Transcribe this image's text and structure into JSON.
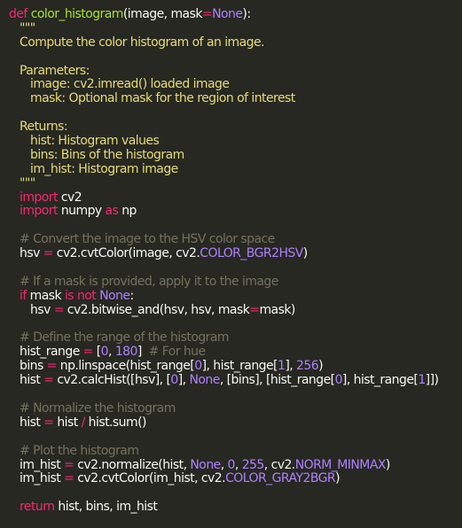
{
  "code": {
    "def_kw": "def",
    "func_name": "color_histogram",
    "func_params_open": "(image, mask",
    "func_eq": "=",
    "func_none": "None",
    "func_params_close": "):",
    "doc_open": "\"\"\"",
    "doc_summary": "Compute the color histogram of an image.",
    "doc_params_header": "Parameters:",
    "doc_param_image": "image: cv2.imread() loaded image",
    "doc_param_mask": "mask: Optional mask for the region of interest",
    "doc_returns_header": "Returns:",
    "doc_ret_hist": "hist: Histogram values",
    "doc_ret_bins": "bins: Bins of the histogram",
    "doc_ret_imhist": "im_hist: Histogram image",
    "doc_close": "\"\"\"",
    "import_kw": "import",
    "import_cv2": " cv2",
    "import_numpy": " numpy ",
    "as_kw": "as",
    "import_np": " np",
    "comment_hsv": "# Convert the image to the HSV color space",
    "hsv_lhs": "hsv ",
    "eq": "=",
    "hsv_rhs_a": " cv2.cvtColor(image, cv2.",
    "hsv_const": "COLOR_BGR2HSV",
    "close_paren": ")",
    "comment_mask": "# If a mask is provided, apply it to the image",
    "if_kw": "if",
    "if_mask": " mask ",
    "is_kw": "is",
    "not_kw": "not",
    "none_kw": "None",
    "colon": ":",
    "bitwise_rhs_a": " cv2.bitwise_and(hsv, hsv, mask",
    "bitwise_rhs_b": "mask)",
    "comment_range": "# Define the range of the histogram",
    "range_lhs": "hist_range ",
    "range_open": " [",
    "num_0": "0",
    "comma_sp": ", ",
    "num_180": "180",
    "range_close": "]  ",
    "comment_hue": "# For hue",
    "bins_lhs": "bins ",
    "bins_rhs_a": " np.linspace(hist_range[",
    "bins_rhs_b": "], hist_range[",
    "num_1": "1",
    "bins_rhs_c": "], ",
    "num_256": "256",
    "calc_lhs": "hist ",
    "calc_rhs_a": " cv2.calcHist([hsv], [",
    "calc_rhs_b": "], ",
    "calc_rhs_c": ", [bins], [hist_range[",
    "calc_rhs_d": "], hist_range[",
    "calc_rhs_e": "]])",
    "comment_norm": "# Normalize the histogram",
    "norm_lhs": "hist ",
    "norm_rhs_a": " hist ",
    "slash": "/",
    "norm_rhs_b": " hist.sum()",
    "comment_plot": "# Plot the histogram",
    "imh_lhs": "im_hist ",
    "imh_rhs_a": " cv2.normalize(hist, ",
    "num_255": "255",
    "imh_rhs_b": ", cv2.",
    "imh_const": "NORM_MINMAX",
    "imh2_rhs_a": " cv2.cvtColor(im_hist, cv2.",
    "imh2_const": "COLOR_GRAY2BGR",
    "return_kw": "return",
    "return_vals": " hist, bins, im_hist"
  }
}
